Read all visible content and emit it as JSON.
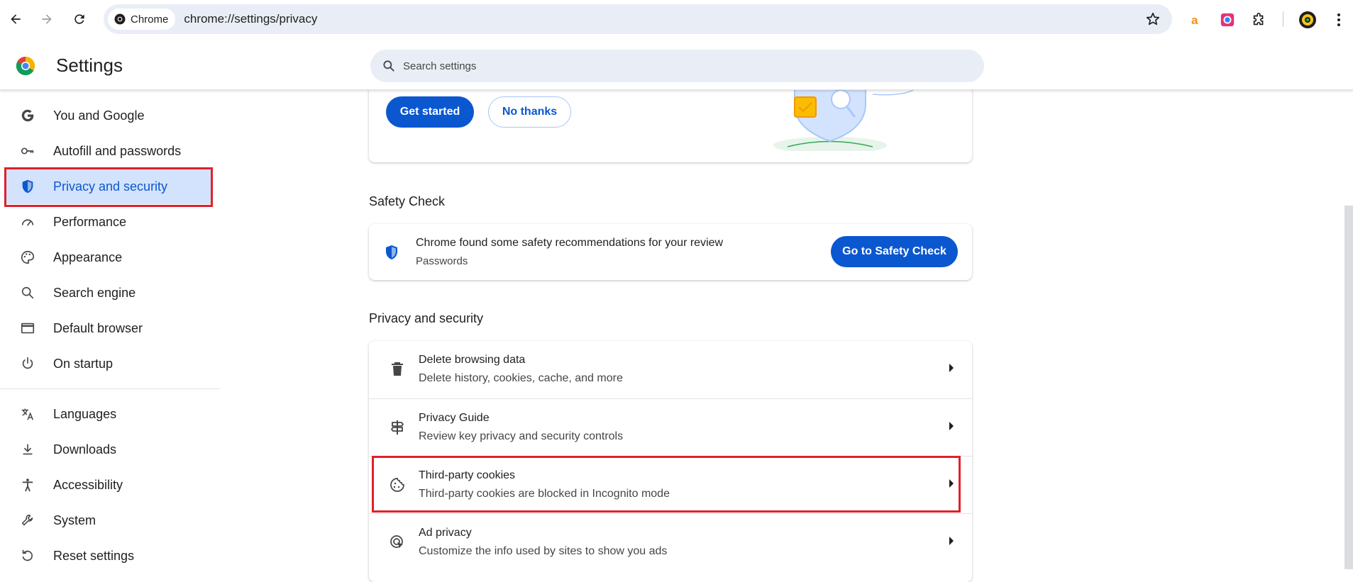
{
  "browser": {
    "chip_label": "Chrome",
    "url": "chrome://settings/privacy"
  },
  "header": {
    "title": "Settings",
    "search_placeholder": "Search settings"
  },
  "sidebar": {
    "items": [
      {
        "label": "You and Google",
        "icon": "google-icon"
      },
      {
        "label": "Autofill and passwords",
        "icon": "key-icon"
      },
      {
        "label": "Privacy and security",
        "icon": "shield-icon",
        "active": true
      },
      {
        "label": "Performance",
        "icon": "speedometer-icon"
      },
      {
        "label": "Appearance",
        "icon": "palette-icon"
      },
      {
        "label": "Search engine",
        "icon": "search-icon"
      },
      {
        "label": "Default browser",
        "icon": "browser-window-icon"
      },
      {
        "label": "On startup",
        "icon": "power-icon"
      },
      {
        "label": "Languages",
        "icon": "translate-icon"
      },
      {
        "label": "Downloads",
        "icon": "download-icon"
      },
      {
        "label": "Accessibility",
        "icon": "accessibility-icon"
      },
      {
        "label": "System",
        "icon": "wrench-icon"
      },
      {
        "label": "Reset settings",
        "icon": "reset-icon"
      }
    ]
  },
  "promo": {
    "primary_button": "Get started",
    "secondary_button": "No thanks"
  },
  "safety_check": {
    "section_title": "Safety Check",
    "message": "Chrome found some safety recommendations for your review",
    "subtext": "Passwords",
    "button": "Go to Safety Check"
  },
  "privacy": {
    "section_title": "Privacy and security",
    "rows": [
      {
        "title": "Delete browsing data",
        "subtitle": "Delete history, cookies, cache, and more",
        "icon": "trash-icon"
      },
      {
        "title": "Privacy Guide",
        "subtitle": "Review key privacy and security controls",
        "icon": "signpost-icon"
      },
      {
        "title": "Third-party cookies",
        "subtitle": "Third-party cookies are blocked in Incognito mode",
        "icon": "cookie-icon"
      },
      {
        "title": "Ad privacy",
        "subtitle": "Customize the info used by sites to show you ads",
        "icon": "ad-privacy-icon"
      }
    ]
  },
  "colors": {
    "accent": "#0b57d0",
    "active_bg": "#d3e3fd",
    "highlight": "#e0202c"
  }
}
